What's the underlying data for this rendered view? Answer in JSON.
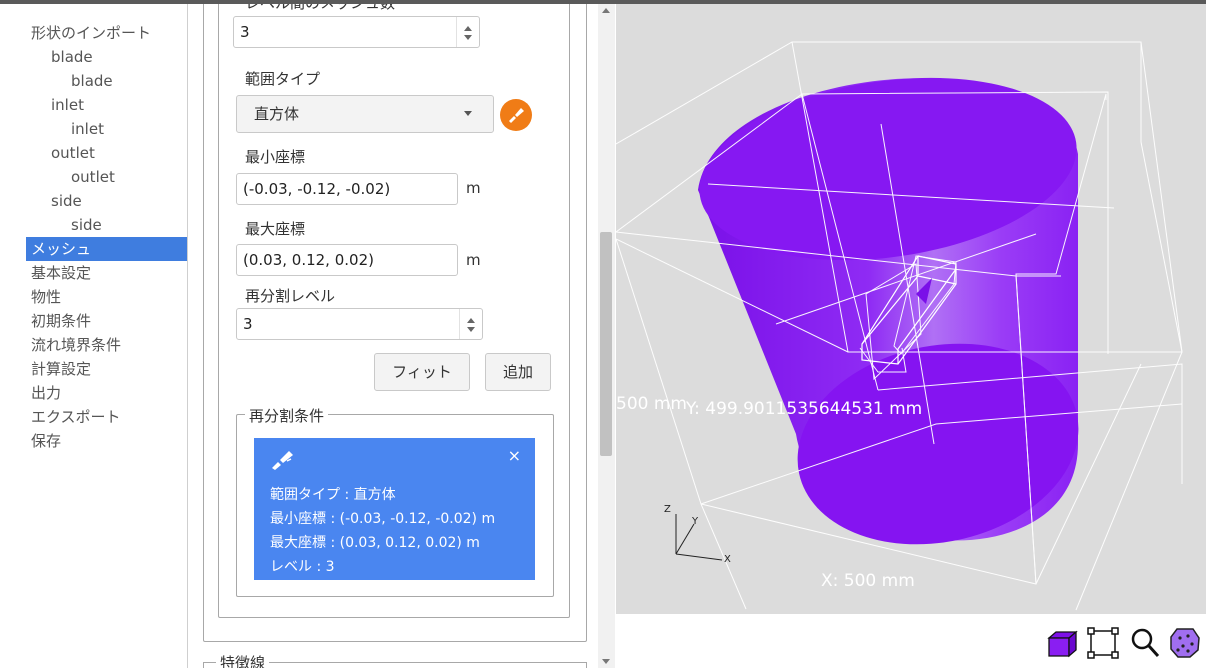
{
  "nav": {
    "items": [
      {
        "label": "形状のインポート",
        "level": 0
      },
      {
        "label": "blade",
        "level": 1
      },
      {
        "label": "blade",
        "level": 2
      },
      {
        "label": "inlet",
        "level": 1
      },
      {
        "label": "inlet",
        "level": 2
      },
      {
        "label": "outlet",
        "level": 1
      },
      {
        "label": "outlet",
        "level": 2
      },
      {
        "label": "side",
        "level": 1
      },
      {
        "label": "side",
        "level": 2
      },
      {
        "label": "メッシュ",
        "level": 0,
        "active": true
      },
      {
        "label": "基本設定",
        "level": 0
      },
      {
        "label": "物性",
        "level": 0
      },
      {
        "label": "初期条件",
        "level": 0
      },
      {
        "label": "流れ境界条件",
        "level": 0
      },
      {
        "label": "計算設定",
        "level": 0
      },
      {
        "label": "出力",
        "level": 0
      },
      {
        "label": "エクスポート",
        "level": 0
      },
      {
        "label": "保存",
        "level": 0
      }
    ]
  },
  "form": {
    "cells_between_levels": {
      "label": "レベル間のメッシュ数",
      "value": "3"
    },
    "range_type": {
      "label": "範囲タイプ",
      "value": "直方体"
    },
    "min_coord": {
      "label": "最小座標",
      "value": "(-0.03, -0.12, -0.02)",
      "unit": "m"
    },
    "max_coord": {
      "label": "最大座標",
      "value": "(0.03, 0.12, 0.02)",
      "unit": "m"
    },
    "refine_level": {
      "label": "再分割レベル",
      "value": "3"
    },
    "fit_label": "フィット",
    "add_label": "追加"
  },
  "conditions": {
    "legend": "再分割条件",
    "card": {
      "range_type": "範囲タイプ : 直方体",
      "min": "最小座標 : (-0.03, -0.12, -0.02) m",
      "max": "最大座標 : (0.03, 0.12, 0.02) m",
      "level": "レベル : 3",
      "close": "×"
    }
  },
  "next_section": {
    "legend": "特徴線"
  },
  "viewport": {
    "y_dim": "Y: 499.9011535644531 mm",
    "x_dim": "X: 500 mm",
    "left_dim": "500 mm",
    "axes": {
      "x": "X",
      "y": "Y",
      "z": "Z"
    },
    "cylinder_color": "#8c1ff2",
    "background": "#dcdcdc"
  },
  "toolbar": {
    "icons": [
      "solid-view-icon",
      "bounding-box-icon",
      "zoom-icon",
      "point-cloud-icon"
    ]
  },
  "colors": {
    "accent": "#3f7ddf",
    "card": "#4a86f0",
    "brush": "#f07c16"
  }
}
